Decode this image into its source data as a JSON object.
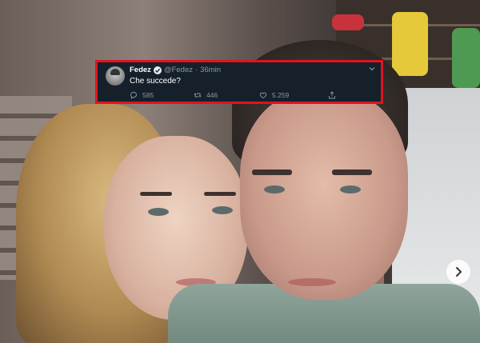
{
  "tweet": {
    "name": "Fedez",
    "handle": "@Fedez",
    "separator": "·",
    "time": "36min",
    "text": "Che succede?",
    "replies": "585",
    "retweets": "446",
    "likes": "5.259",
    "icons": [
      "avatar",
      "verified-badge-icon",
      "chevron-down-icon",
      "reply-icon",
      "retweet-icon",
      "like-icon",
      "share-icon"
    ],
    "highlight_color": "#e0141f",
    "background_color": "#15202b"
  },
  "photo": {
    "icons": [
      "next-arrow-icon"
    ]
  }
}
